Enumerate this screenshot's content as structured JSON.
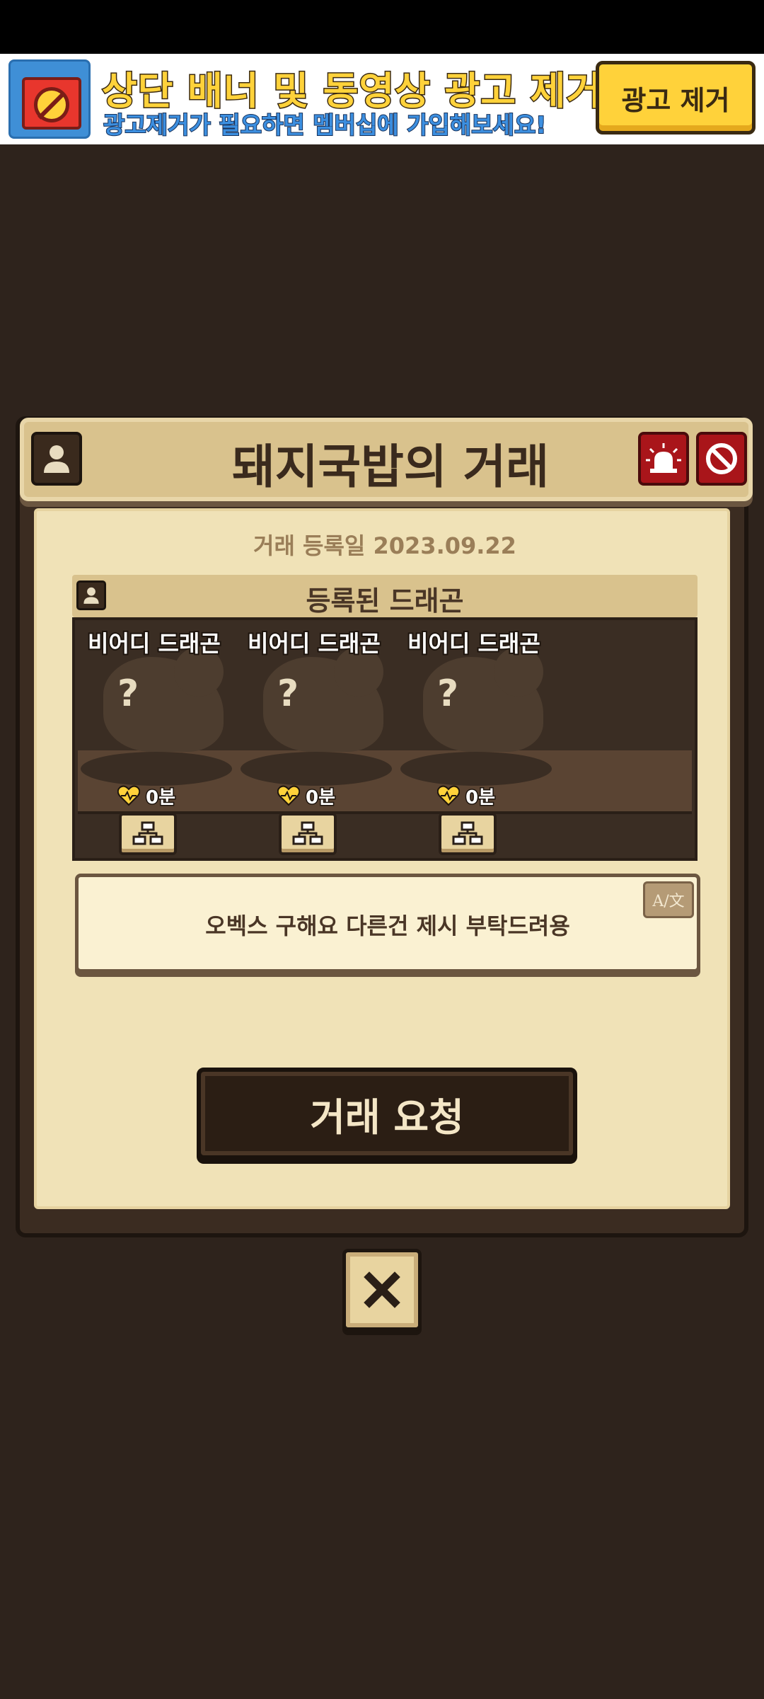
{
  "ad": {
    "title": "상단 배너 및 동영상 광고 제거!",
    "subtitle": "광고제거가 필요하면 멤버십에 가입해보세요!",
    "remove_label": "광고 제거"
  },
  "dialog": {
    "title": "돼지국밥의 거래",
    "registered_date": "거래 등록일 2023.09.22",
    "dragons_header": "등록된 드래곤",
    "dragons": [
      {
        "name": "비어디 드래곤",
        "unknown": "?",
        "time": "0분"
      },
      {
        "name": "비어디 드래곤",
        "unknown": "?",
        "time": "0분"
      },
      {
        "name": "비어디 드래곤",
        "unknown": "?",
        "time": "0분"
      }
    ],
    "message": "오벡스 구해요 다른건 제시 부탁드려용",
    "translate_label": "A/文",
    "trade_request_label": "거래 요청"
  },
  "colors": {
    "accent_gold": "#ffd23a",
    "report_red": "#a9151a",
    "panel_bg": "#f0e2b7"
  }
}
